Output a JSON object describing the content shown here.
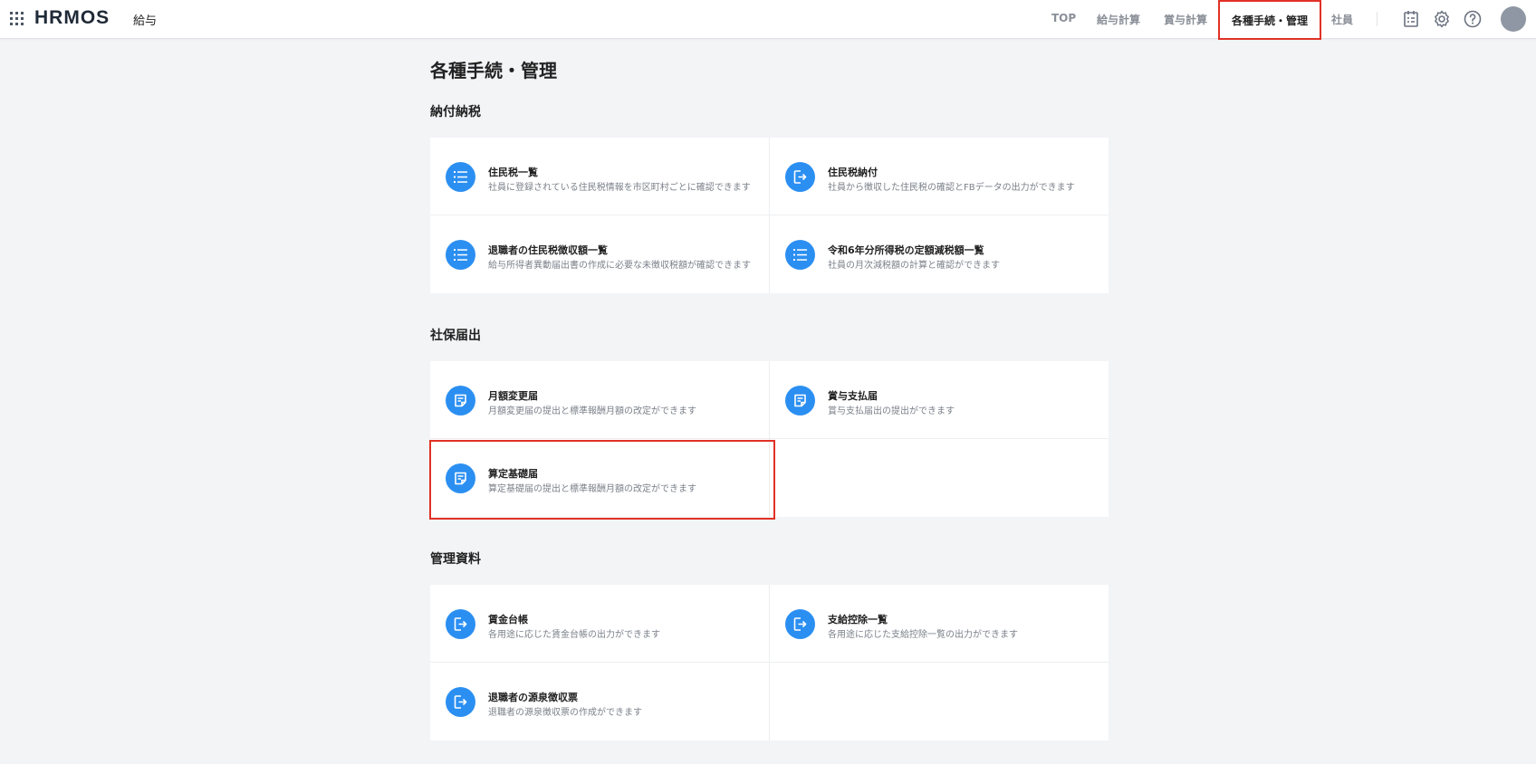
{
  "header": {
    "logo": "HRMOS",
    "product": "給与",
    "nav": [
      {
        "label": "TOP"
      },
      {
        "label": "給与計算"
      },
      {
        "label": "賞与計算"
      },
      {
        "label": "各種手続・管理"
      },
      {
        "label": "社員"
      }
    ]
  },
  "page": {
    "title": "各種手続・管理"
  },
  "sections": [
    {
      "title": "納付納税",
      "cards": [
        {
          "title": "住民税一覧",
          "desc": "社員に登録されている住民税情報を市区町村ごとに確認できます",
          "icon": "list-icon"
        },
        {
          "title": "住民税納付",
          "desc": "社員から徴収した住民税の確認とFBデータの出力ができます",
          "icon": "export-icon"
        },
        {
          "title": "退職者の住民税徴収額一覧",
          "desc": "給与所得者異動届出書の作成に必要な未徴収税額が確認できます",
          "icon": "list-icon"
        },
        {
          "title": "令和6年分所得税の定額減税額一覧",
          "desc": "社員の月次減税額の計算と確認ができます",
          "icon": "list-icon"
        }
      ]
    },
    {
      "title": "社保届出",
      "cards": [
        {
          "title": "月額変更届",
          "desc": "月額変更届の提出と標準報酬月額の改定ができます",
          "icon": "note-icon"
        },
        {
          "title": "賞与支払届",
          "desc": "賞与支払届出の提出ができます",
          "icon": "note-icon"
        },
        {
          "title": "算定基礎届",
          "desc": "算定基礎届の提出と標準報酬月額の改定ができます",
          "icon": "note-icon"
        }
      ]
    },
    {
      "title": "管理資料",
      "cards": [
        {
          "title": "賃金台帳",
          "desc": "各用途に応じた賃金台帳の出力ができます",
          "icon": "export-icon"
        },
        {
          "title": "支給控除一覧",
          "desc": "各用途に応じた支給控除一覧の出力ができます",
          "icon": "export-icon"
        },
        {
          "title": "退職者の源泉徴収票",
          "desc": "退職者の源泉徴収票の作成ができます",
          "icon": "export-icon"
        }
      ]
    }
  ],
  "colors": {
    "accent": "#2b8ff2",
    "highlight": "#e03125",
    "background": "#f3f4f6"
  }
}
